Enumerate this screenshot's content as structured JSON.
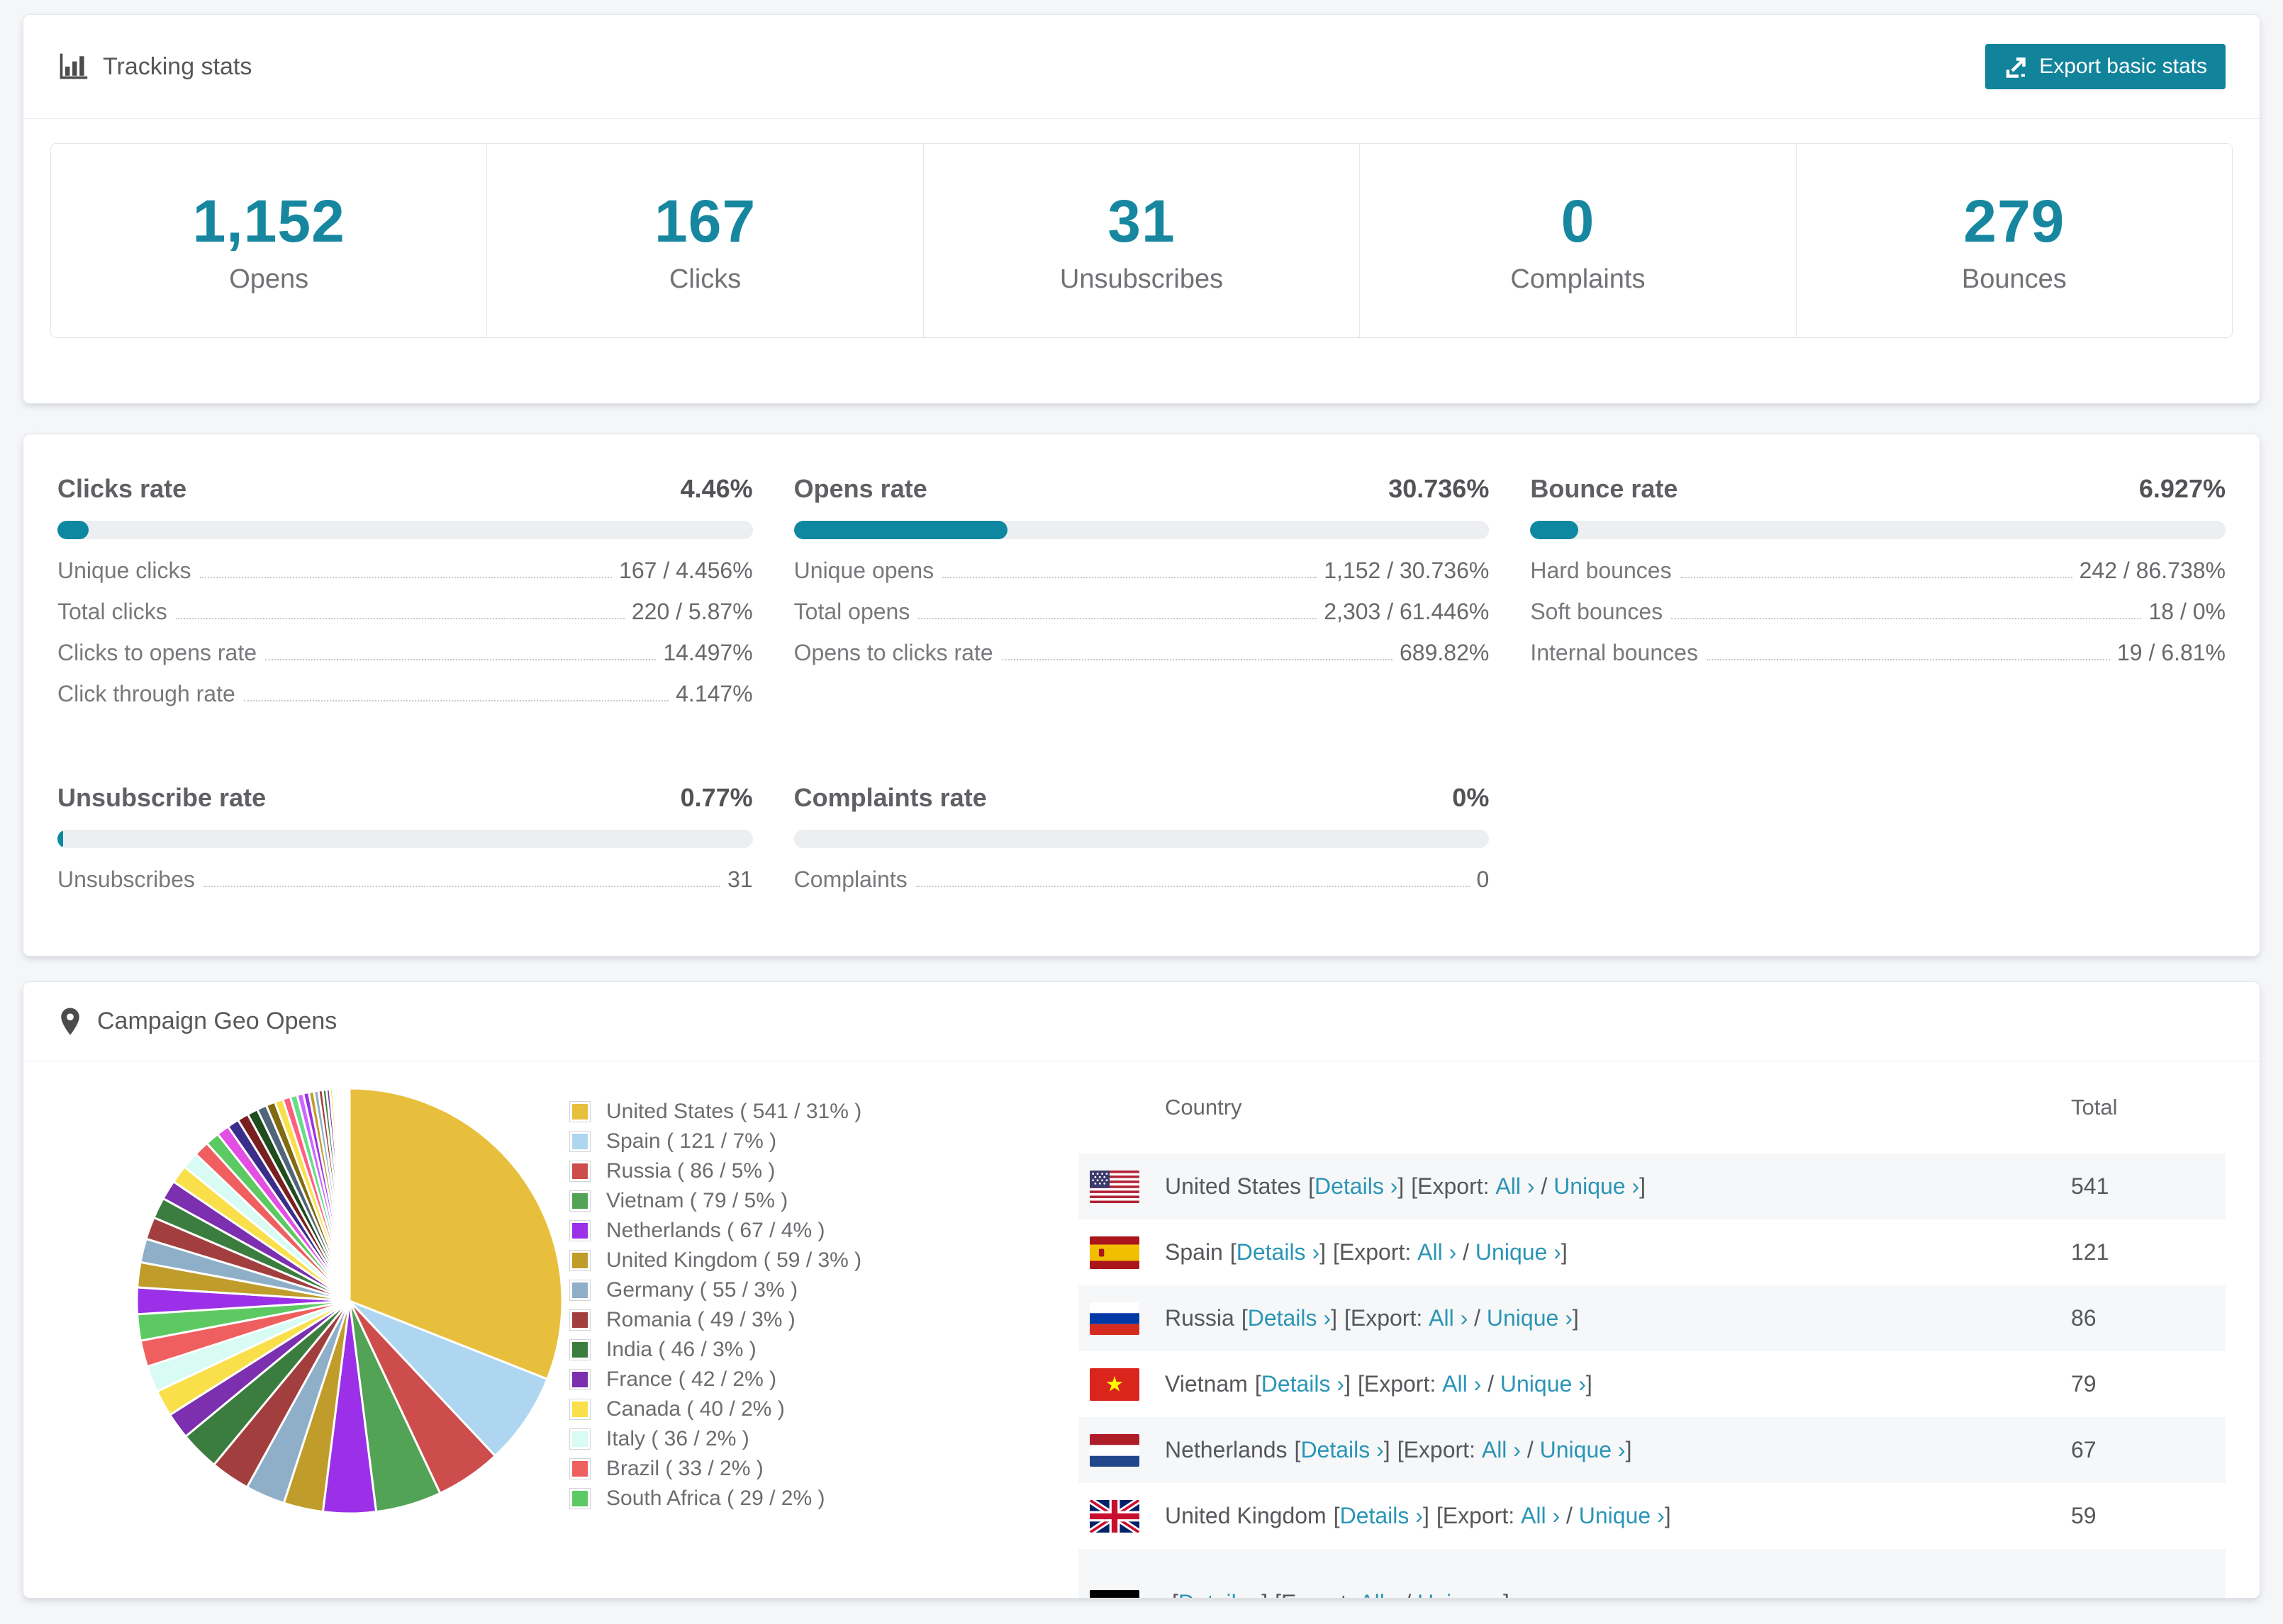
{
  "colors": {
    "accent": "#1787a0",
    "button": "#11839b",
    "link": "#2b95b6",
    "bar_track": "#eceef1"
  },
  "tracking": {
    "title": "Tracking stats",
    "export_label": "Export basic stats",
    "stats": [
      {
        "value": "1,152",
        "label": "Opens"
      },
      {
        "value": "167",
        "label": "Clicks"
      },
      {
        "value": "31",
        "label": "Unsubscribes"
      },
      {
        "value": "0",
        "label": "Complaints"
      },
      {
        "value": "279",
        "label": "Bounces"
      }
    ]
  },
  "rates": [
    {
      "title": "Clicks rate",
      "value": "4.46%",
      "percent": 4.46,
      "rows": [
        {
          "label": "Unique clicks",
          "value": "167 / 4.456%"
        },
        {
          "label": "Total clicks",
          "value": "220 / 5.87%"
        },
        {
          "label": "Clicks to opens rate",
          "value": "14.497%"
        },
        {
          "label": "Click through rate",
          "value": "4.147%"
        }
      ]
    },
    {
      "title": "Opens rate",
      "value": "30.736%",
      "percent": 30.736,
      "rows": [
        {
          "label": "Unique opens",
          "value": "1,152 / 30.736%"
        },
        {
          "label": "Total opens",
          "value": "2,303 / 61.446%"
        },
        {
          "label": "Opens to clicks rate",
          "value": "689.82%"
        }
      ]
    },
    {
      "title": "Bounce rate",
      "value": "6.927%",
      "percent": 6.927,
      "rows": [
        {
          "label": "Hard bounces",
          "value": "242 / 86.738%"
        },
        {
          "label": "Soft bounces",
          "value": "18 / 0%"
        },
        {
          "label": "Internal bounces",
          "value": "19 / 6.81%"
        }
      ]
    },
    {
      "title": "Unsubscribe rate",
      "value": "0.77%",
      "percent": 0.77,
      "rows": [
        {
          "label": "Unsubscribes",
          "value": "31"
        }
      ]
    },
    {
      "title": "Complaints rate",
      "value": "0%",
      "percent": 0,
      "rows": [
        {
          "label": "Complaints",
          "value": "0"
        }
      ]
    }
  ],
  "chart_data": {
    "type": "pie",
    "title": "Campaign Geo Opens",
    "unit": "opens",
    "start_angle_deg": -90,
    "direction": "clockwise",
    "legend_position": "right",
    "legend_format": "{label} ( {count} / {percent}% )",
    "slices": [
      {
        "label": "United States",
        "count": 541,
        "percent": 31,
        "color": "#e8bf3c"
      },
      {
        "label": "Spain",
        "count": 121,
        "percent": 7,
        "color": "#aed6f1"
      },
      {
        "label": "Russia",
        "count": 86,
        "percent": 5,
        "color": "#cd4d4d"
      },
      {
        "label": "Vietnam",
        "count": 79,
        "percent": 5,
        "color": "#52a355"
      },
      {
        "label": "Netherlands",
        "count": 67,
        "percent": 4,
        "color": "#9b30e8"
      },
      {
        "label": "United Kingdom",
        "count": 59,
        "percent": 3,
        "color": "#c09c2a"
      },
      {
        "label": "Germany",
        "count": 55,
        "percent": 3,
        "color": "#8fafc9"
      },
      {
        "label": "Romania",
        "count": 49,
        "percent": 3,
        "color": "#a33e3e"
      },
      {
        "label": "India",
        "count": 46,
        "percent": 3,
        "color": "#3b7d3f"
      },
      {
        "label": "France",
        "count": 42,
        "percent": 2,
        "color": "#7c2fae"
      },
      {
        "label": "Canada",
        "count": 40,
        "percent": 2,
        "color": "#f9e04b"
      },
      {
        "label": "Italy",
        "count": 36,
        "percent": 2,
        "color": "#d8fbf4"
      },
      {
        "label": "Brazil",
        "count": 33,
        "percent": 2,
        "color": "#ef5f5f"
      },
      {
        "label": "South Africa",
        "count": 29,
        "percent": 2,
        "color": "#5cc963"
      }
    ],
    "other_slices_percent": [
      1.9,
      1.8,
      1.7,
      1.6,
      1.5,
      1.4,
      1.3,
      1.2,
      1.1,
      1.0,
      0.9,
      0.85,
      0.8,
      0.75,
      0.7,
      0.65,
      0.6,
      0.55,
      0.5,
      0.45,
      0.4,
      0.36,
      0.33,
      0.3,
      0.27,
      0.24,
      0.21,
      0.18,
      0.16,
      0.14,
      0.12,
      0.1,
      0.09,
      0.08,
      0.07,
      0.06,
      0.05,
      0.04,
      0.03,
      0.03,
      0.02,
      0.02
    ],
    "other_palette": [
      "#9b30e8",
      "#c09c2a",
      "#8fafc9",
      "#a33e3e",
      "#3b7d3f",
      "#7c2fae",
      "#f9e04b",
      "#d8fbf4",
      "#ef5f5f",
      "#5cc963",
      "#e24fe2",
      "#3a2e8a",
      "#7a1f1f",
      "#1f4d1f",
      "#51657a",
      "#806a12",
      "#f9e04b",
      "#ff5f7e",
      "#66dd88",
      "#cc66ff"
    ]
  },
  "geo": {
    "title": "Campaign Geo Opens",
    "table": {
      "headers": [
        "Country",
        "Total"
      ],
      "link_parts": {
        "open": "[",
        "close": "]",
        "slash": "/",
        "details": "Details ›",
        "export_label": "Export:",
        "all": "All ›",
        "unique": "Unique ›"
      },
      "rows": [
        {
          "flag": "us",
          "country": "United States",
          "total": "541"
        },
        {
          "flag": "es",
          "country": "Spain",
          "total": "121"
        },
        {
          "flag": "ru",
          "country": "Russia",
          "total": "86"
        },
        {
          "flag": "vn",
          "country": "Vietnam",
          "total": "79"
        },
        {
          "flag": "nl",
          "country": "Netherlands",
          "total": "67"
        },
        {
          "flag": "gb",
          "country": "United Kingdom",
          "total": "59"
        },
        {
          "flag": "de",
          "country": "",
          "total": "",
          "partial": true
        }
      ]
    }
  }
}
